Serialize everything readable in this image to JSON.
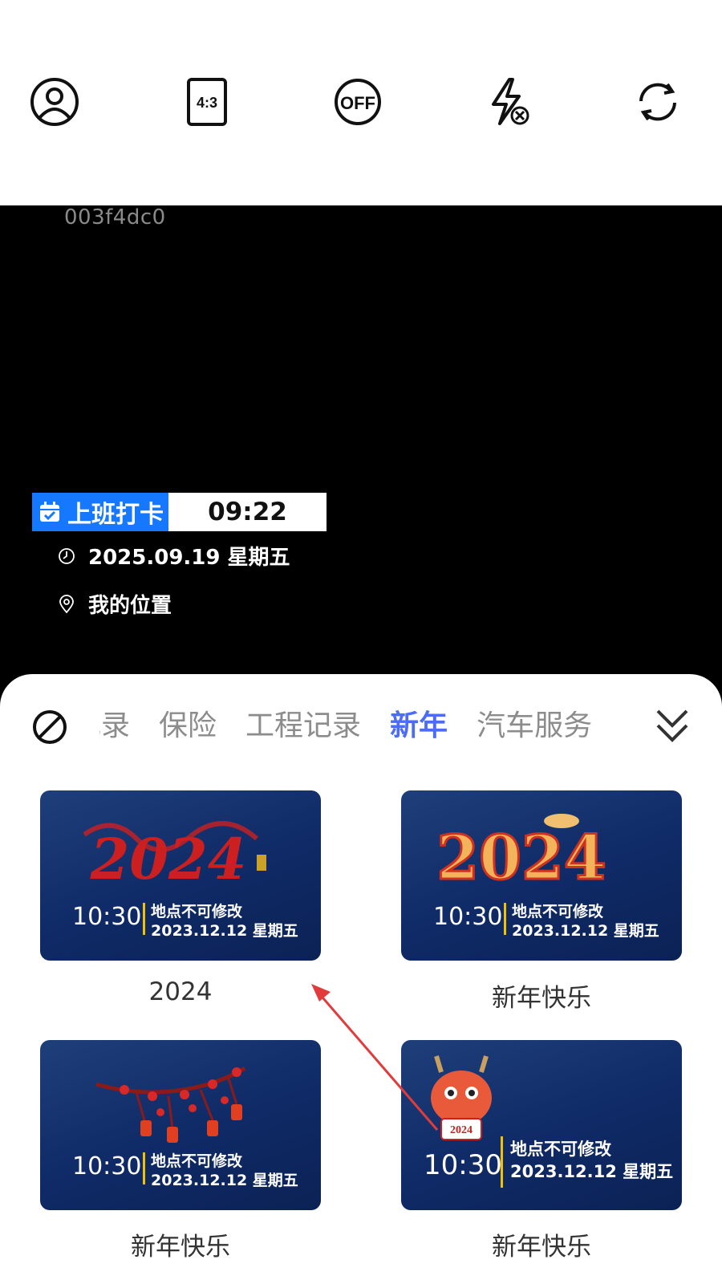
{
  "toolbar": {
    "buttons": [
      {
        "name": "profile-icon"
      },
      {
        "name": "aspect-ratio-icon",
        "label": "4:3"
      },
      {
        "name": "timer-off-icon",
        "label": "OFF"
      },
      {
        "name": "flash-off-icon"
      },
      {
        "name": "switch-camera-icon"
      }
    ]
  },
  "viewfinder": {
    "device_id": "003f4dc0",
    "stamp": {
      "title": "上班打卡",
      "time": "09:22",
      "date": "2025.09.19 星期五",
      "location": "我的位置"
    }
  },
  "categories": {
    "items": [
      "记录",
      "保险",
      "工程记录",
      "新年",
      "汽车服务"
    ],
    "active": "新年",
    "active_color": "#4a6cf7"
  },
  "templates": [
    {
      "caption": "2024",
      "time": "10:30",
      "location": "地点不可修改",
      "date": "2023.12.12 星期五",
      "art": "2024",
      "art_color": "#cc1f1f"
    },
    {
      "caption": "新年快乐",
      "time": "10:30",
      "location": "地点不可修改",
      "date": "2023.12.12 星期五",
      "art": "2024",
      "art_color": "#f3b35a"
    },
    {
      "caption": "新年快乐",
      "time": "10:30",
      "location": "地点不可修改",
      "date": "2023.12.12 星期五",
      "art": "",
      "art_color": "#d82828"
    },
    {
      "caption": "新年快乐",
      "time": "10:30",
      "location": "地点不可修改",
      "date": "2023.12.12 星期五",
      "art": "2024",
      "art_color": "#e85a3a"
    }
  ]
}
